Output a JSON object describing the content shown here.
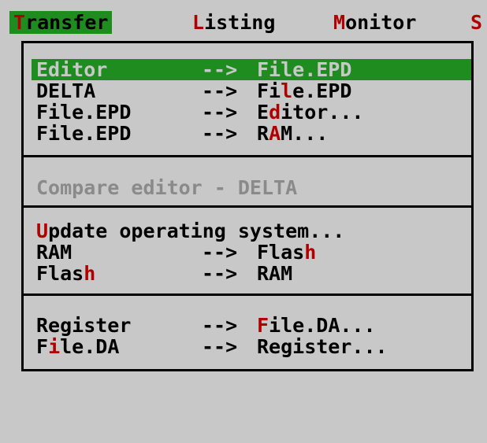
{
  "menubar": {
    "items": [
      {
        "hot": "T",
        "rest": "ransfer"
      },
      {
        "hot": "L",
        "rest": "isting"
      },
      {
        "hot": "M",
        "rest": "onitor"
      },
      {
        "hot": "S",
        "rest": ""
      }
    ]
  },
  "menu": {
    "group1": [
      {
        "from": "Editor",
        "arrow": "-->",
        "to_pre": "",
        "to_hot": "",
        "to_post": "File.EPD"
      },
      {
        "from": "DELTA",
        "arrow": "-->",
        "to_pre": "Fi",
        "to_hot": "l",
        "to_post": "e.EPD"
      },
      {
        "from": "File.EPD",
        "arrow": "-->",
        "to_pre": "E",
        "to_hot": "d",
        "to_post": "itor..."
      },
      {
        "from": "File.EPD",
        "arrow": "-->",
        "to_pre": "R",
        "to_hot": "A",
        "to_post": "M..."
      }
    ],
    "compare": "Compare editor - DELTA",
    "group3": {
      "update_hot": "U",
      "update_rest": "pdate operating system...",
      "ram_to_flash": {
        "from": "RAM",
        "arrow": "-->",
        "to_pre": "Flas",
        "to_hot": "h"
      },
      "flash_to_ram": {
        "from_pre": "Flas",
        "from_hot": "h",
        "arrow": "-->",
        "to": "RAM"
      }
    },
    "group4": {
      "reg_to_file": {
        "from": "Register",
        "arrow": "-->",
        "to_hot": "F",
        "to_rest": "ile.DA..."
      },
      "file_to_reg": {
        "from_pre": "F",
        "from_hot": "i",
        "from_rest": "le.DA",
        "arrow": "-->",
        "to": "Register..."
      }
    }
  },
  "colors": {
    "background": "#c8c8c8",
    "highlight": "#1e8c1e",
    "hotkey": "#b00000",
    "disabled": "#8a8a8a"
  }
}
